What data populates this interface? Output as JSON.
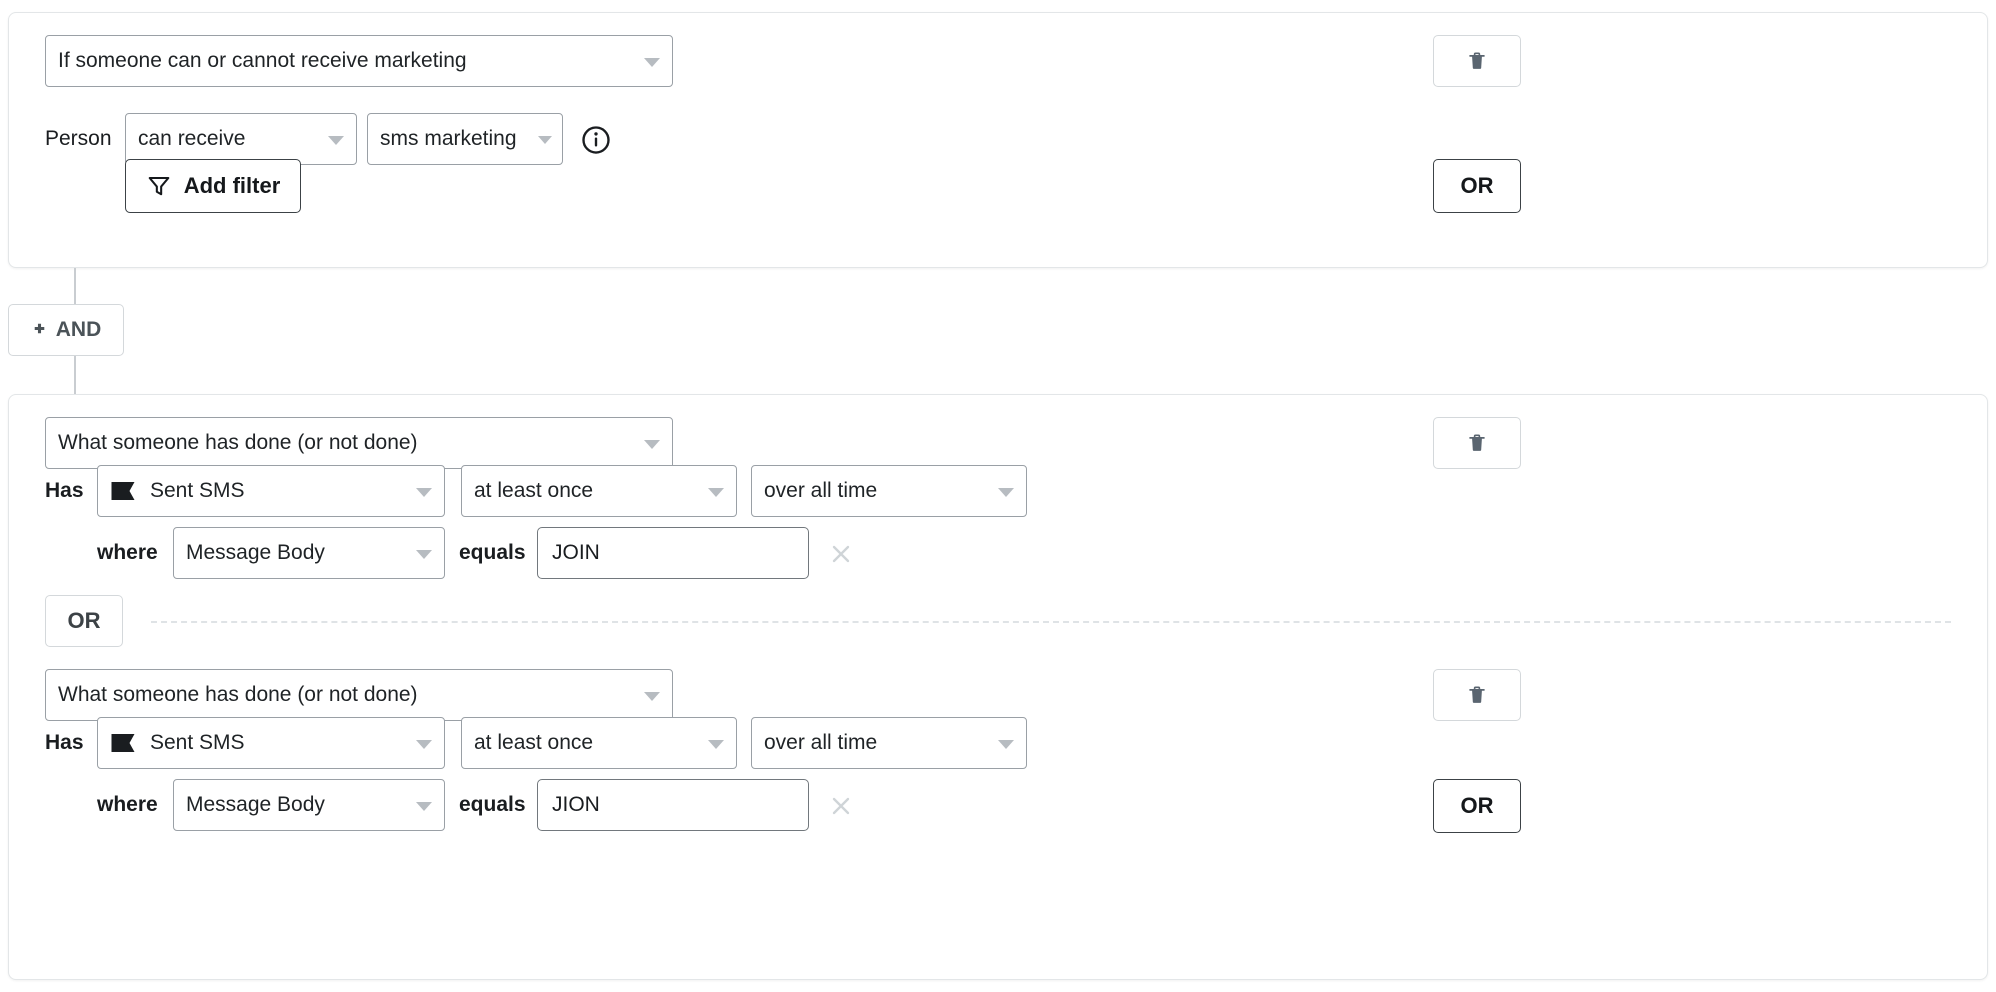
{
  "groups": [
    {
      "name": "group-1",
      "definition": {
        "label": "If someone can or cannot receive marketing",
        "icon": "chevron-down-icon"
      },
      "rows": [
        {
          "prefix": "Person",
          "fields": [
            {
              "kind": "select",
              "value": "can receive"
            },
            {
              "kind": "select",
              "value": "sms marketing"
            }
          ],
          "info_icon": "info-icon"
        }
      ],
      "add_filter": {
        "label": "Add filter",
        "icon": "funnel-icon"
      },
      "delete_icon": "trash-icon",
      "or_button": "OR"
    },
    {
      "name": "group-2",
      "conditions": [
        {
          "definition": {
            "label": "What someone has done (or not done)",
            "icon": "chevron-down-icon"
          },
          "delete_icon": "trash-icon",
          "has_label": "Has",
          "metric": {
            "label": "Sent SMS",
            "icon": "flag-icon"
          },
          "frequency": "at least once",
          "timeframe": "over all time",
          "where_label": "where",
          "property": "Message Body",
          "operator_label": "equals",
          "value": "JOIN",
          "clear_icon": "close-icon",
          "or_button": null
        },
        {
          "definition": {
            "label": "What someone has done (or not done)",
            "icon": "chevron-down-icon"
          },
          "delete_icon": "trash-icon",
          "has_label": "Has",
          "metric": {
            "label": "Sent SMS",
            "icon": "flag-icon"
          },
          "frequency": "at least once",
          "timeframe": "over all time",
          "where_label": "where",
          "property": "Message Body",
          "operator_label": "equals",
          "value": "JION",
          "clear_icon": "close-icon",
          "or_button": "OR"
        }
      ],
      "inner_or_button": "OR"
    }
  ],
  "and_connector": {
    "label": "AND",
    "prefix": "+",
    "icon": "plus-icon"
  },
  "colors": {
    "panel_border": "#e3e6e8",
    "select_border": "#9aa0a6",
    "input_border": "#72787d",
    "strong_border": "#3c4246",
    "muted_text": "#4b5358",
    "text": "#1a1d20",
    "caret": "#b7bcc1",
    "clear": "#cfd4d7",
    "connector": "#c9cdd1"
  }
}
